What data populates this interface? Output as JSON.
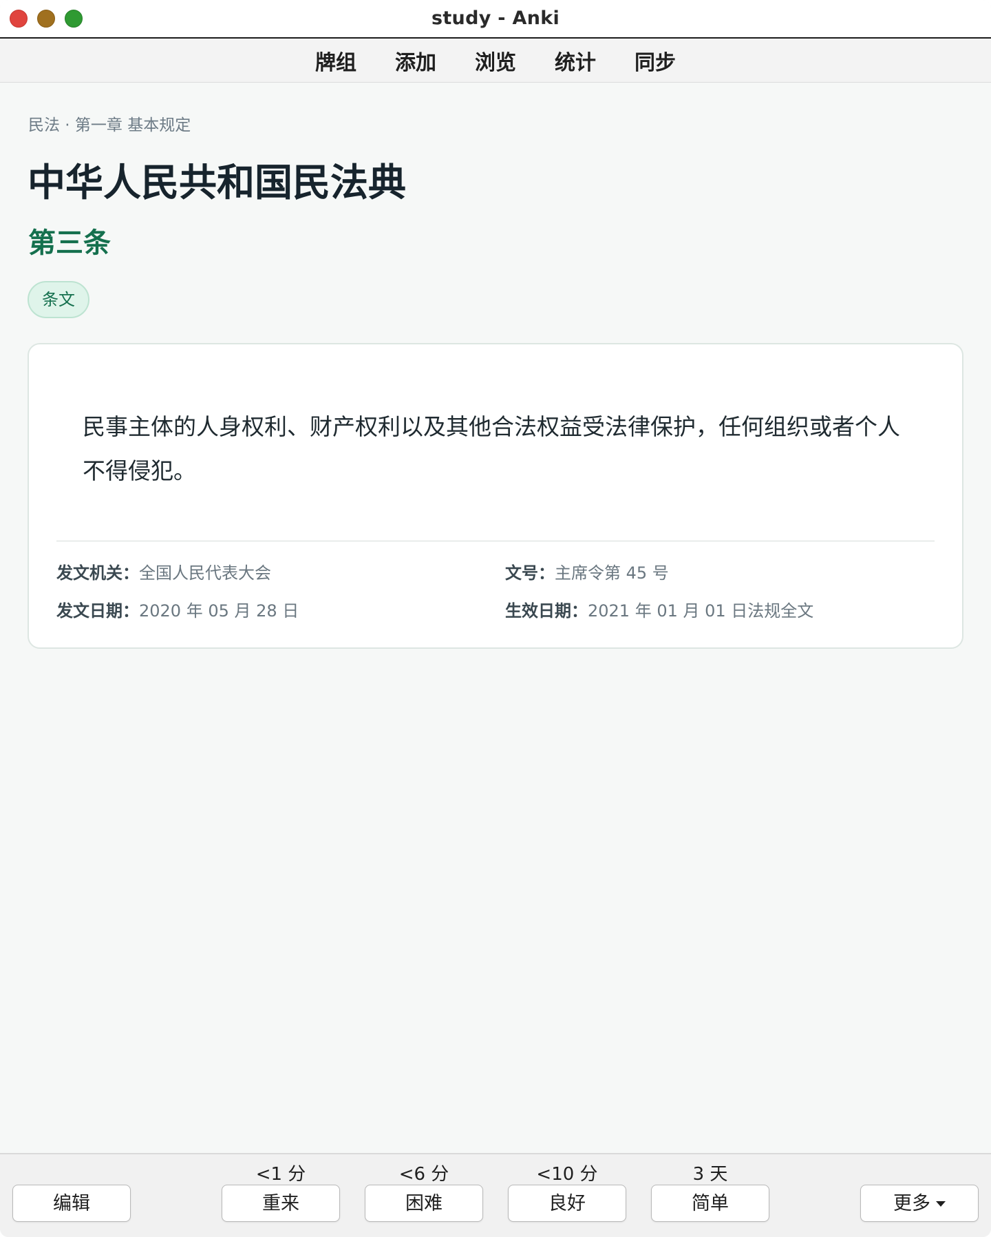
{
  "window": {
    "title": "study - Anki"
  },
  "toolbar": {
    "items": [
      "牌组",
      "添加",
      "浏览",
      "统计",
      "同步"
    ]
  },
  "main": {
    "breadcrumb": "民法 · 第一章 基本规定",
    "title": "中华人民共和国民法典",
    "article_no": "第三条",
    "tag": "条文",
    "article_text": "民事主体的人身权利、财产权利以及其他合法权益受法律保护，任何组织或者个人不得侵犯。",
    "meta": {
      "issuer_label": "发文机关：",
      "issuer": "全国人民代表大会",
      "doc_no_label": "文号：",
      "doc_no": "主席令第 45 号",
      "issue_date_label": "发文日期：",
      "issue_date": "2020 年 05 月 28 日",
      "effective_date_label": "生效日期：",
      "effective_date": "2021 年 01 月 01 日法规全文"
    }
  },
  "bottom": {
    "edit_label": "编辑",
    "more_label": "更多",
    "answers": [
      {
        "interval": "<1 分",
        "label": "重来"
      },
      {
        "interval": "<6 分",
        "label": "困难"
      },
      {
        "interval": "<10 分",
        "label": "良好"
      },
      {
        "interval": "3 天",
        "label": "简单"
      }
    ]
  }
}
